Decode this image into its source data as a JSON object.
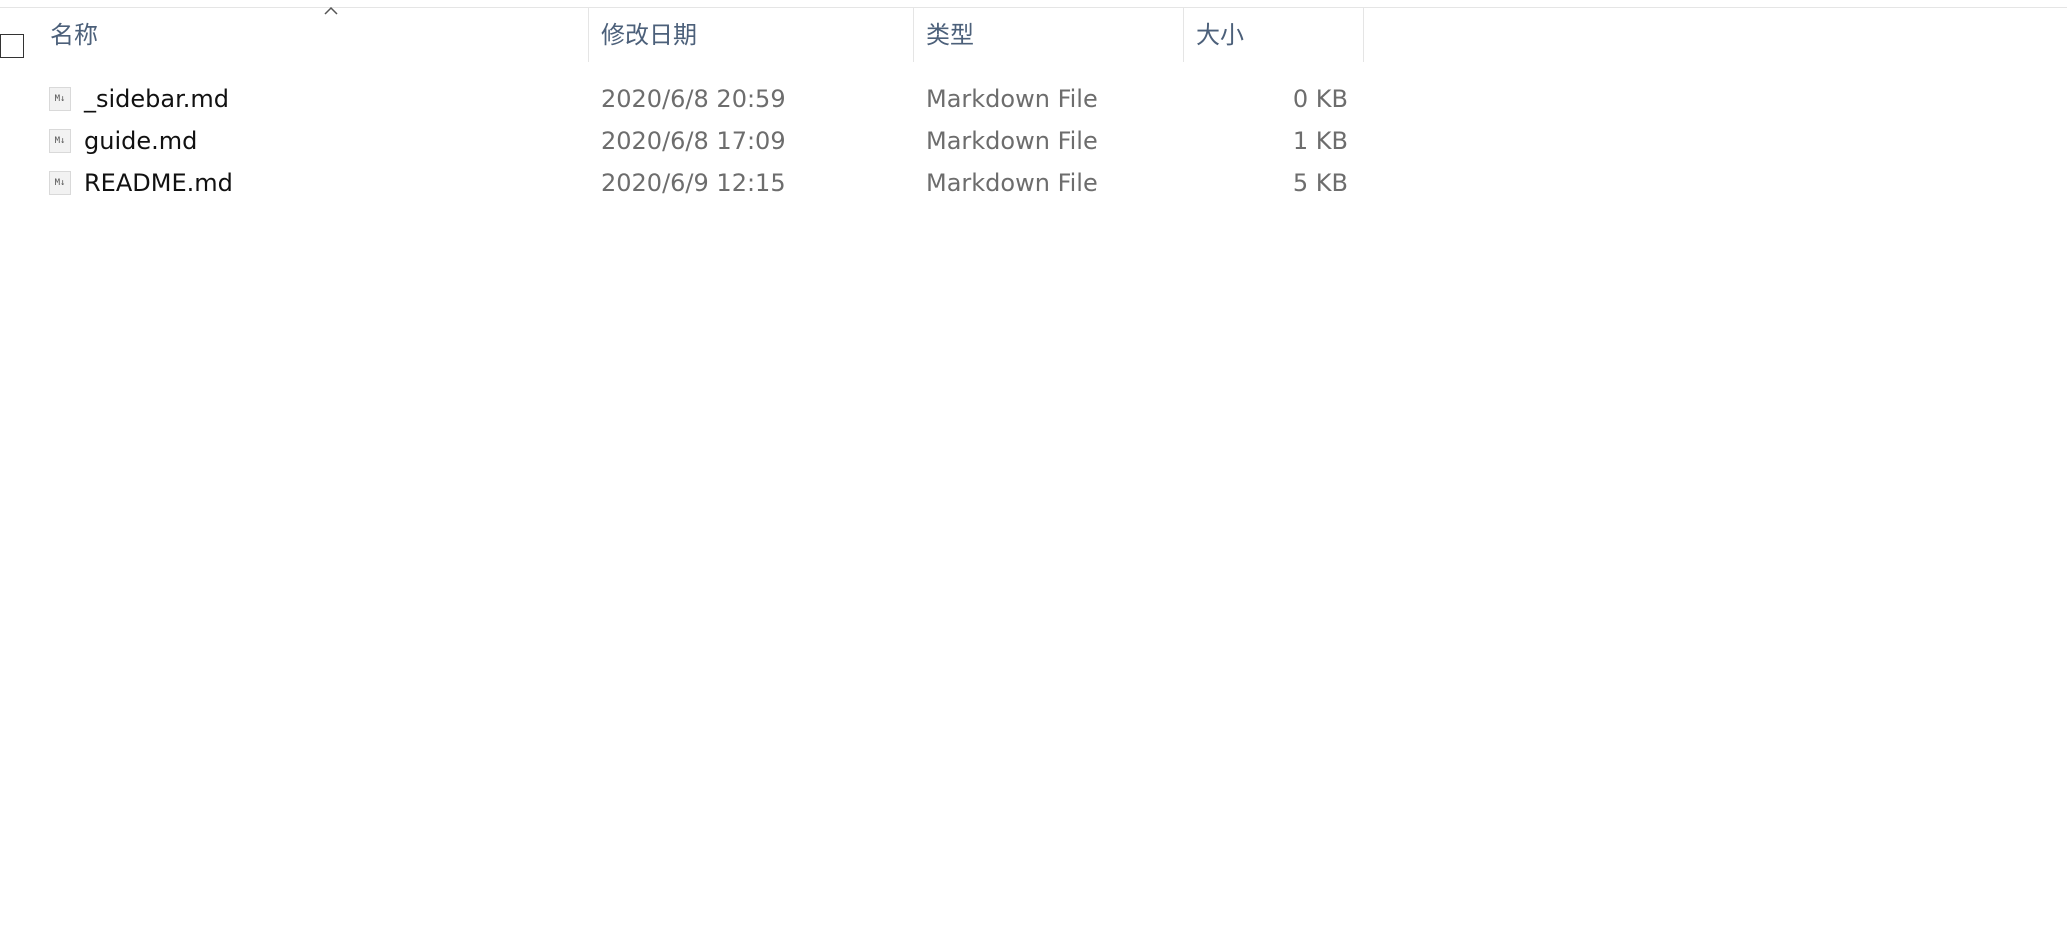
{
  "header": {
    "columns": {
      "name": "名称",
      "date": "修改日期",
      "type": "类型",
      "size": "大小"
    },
    "sort": {
      "column": "name",
      "direction": "ascending",
      "icon": "chevron-up-icon"
    }
  },
  "files": [
    {
      "name": "_sidebar.md",
      "date": "2020/6/8 20:59",
      "type": "Markdown File",
      "size": "0 KB",
      "icon": "M↓"
    },
    {
      "name": "guide.md",
      "date": "2020/6/8 17:09",
      "type": "Markdown File",
      "size": "1 KB",
      "icon": "M↓"
    },
    {
      "name": "README.md",
      "date": "2020/6/9 12:15",
      "type": "Markdown File",
      "size": "5 KB",
      "icon": "M↓"
    }
  ],
  "colors": {
    "header_text": "#4c607a",
    "row_text": "#111111",
    "meta_text": "#6d6d6d",
    "divider": "#e5e5e5"
  }
}
